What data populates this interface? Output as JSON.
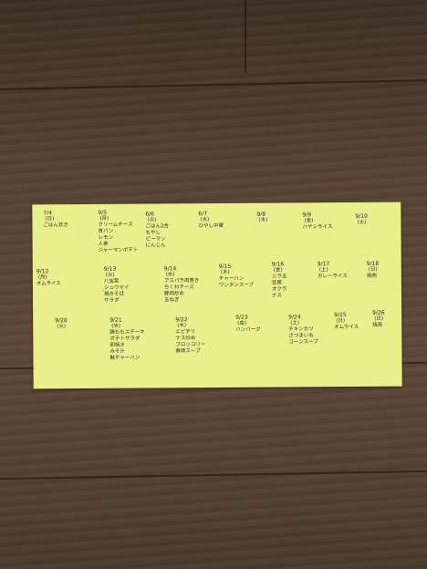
{
  "note": {
    "entries": [
      {
        "date": "7/4",
        "day": "(日)",
        "lines": [
          "ごはん炊き"
        ]
      },
      {
        "date": "9/5",
        "day": "(月)",
        "lines": [
          "クリームチーズ",
          "食パン",
          "レモン",
          "人参",
          "ジャーマンポテト"
        ]
      },
      {
        "date": "6/6",
        "day": "(火)",
        "lines": [
          "ごはん2合",
          "もやし",
          "ピーマン",
          "にんじん"
        ]
      },
      {
        "date": "6/7",
        "day": "(水)",
        "lines": [
          "ひやし中華"
        ]
      },
      {
        "date": "9/8",
        "day": "(木)",
        "lines": []
      },
      {
        "date": "9/9",
        "day": "(金)",
        "lines": [
          "ハヤシライス"
        ]
      },
      {
        "date": "9/10",
        "day": "(土)",
        "lines": []
      },
      {
        "date": "9/12",
        "day": "(月)",
        "lines": [
          "オムライス"
        ]
      },
      {
        "date": "9/13",
        "day": "(火)",
        "lines": [
          "八宝菜",
          "シュウマイ",
          "焼きそば",
          "サラダ"
        ]
      },
      {
        "date": "9/14",
        "day": "(水)",
        "lines": [
          "アスパラ肉巻き",
          "ちくわチーズ",
          "豚肉炒め",
          "玉ねぎ"
        ]
      },
      {
        "date": "9/15",
        "day": "(木)",
        "lines": [
          "チャーハン",
          "ワンタンスープ"
        ]
      },
      {
        "date": "9/16",
        "day": "(金)",
        "lines": [
          "ニラ玉",
          "豆腐",
          "オクラ",
          "ナス"
        ]
      },
      {
        "date": "9/17",
        "day": "(土)",
        "lines": [
          "カレーライス"
        ]
      },
      {
        "date": "9/18",
        "day": "(日)",
        "lines": [
          "焼肉"
        ]
      },
      {
        "date": "9/20",
        "day": "(火)",
        "lines": []
      },
      {
        "date": "9/21",
        "day": "(水)",
        "lines": [
          "鶏ももステーキ",
          "ポテトサラダ",
          "卵焼き",
          "みそ汁",
          "鮭チャーハン"
        ]
      },
      {
        "date": "9/22",
        "day": "(木)",
        "lines": [
          "エビチリ",
          "ナス炒め",
          "ブロッコリー",
          "春雨スープ"
        ]
      },
      {
        "date": "9/23",
        "day": "(金)",
        "lines": [
          "ハンバーグ"
        ]
      },
      {
        "date": "9/24",
        "day": "(土)",
        "lines": [
          "チキンカツ",
          "さつまいも",
          "コーンスープ"
        ]
      },
      {
        "date": "9/25",
        "day": "(日)",
        "lines": [
          "オムライス"
        ]
      },
      {
        "date": "9/26",
        "day": "(日)",
        "lines": [
          "焼鳥"
        ]
      }
    ]
  }
}
